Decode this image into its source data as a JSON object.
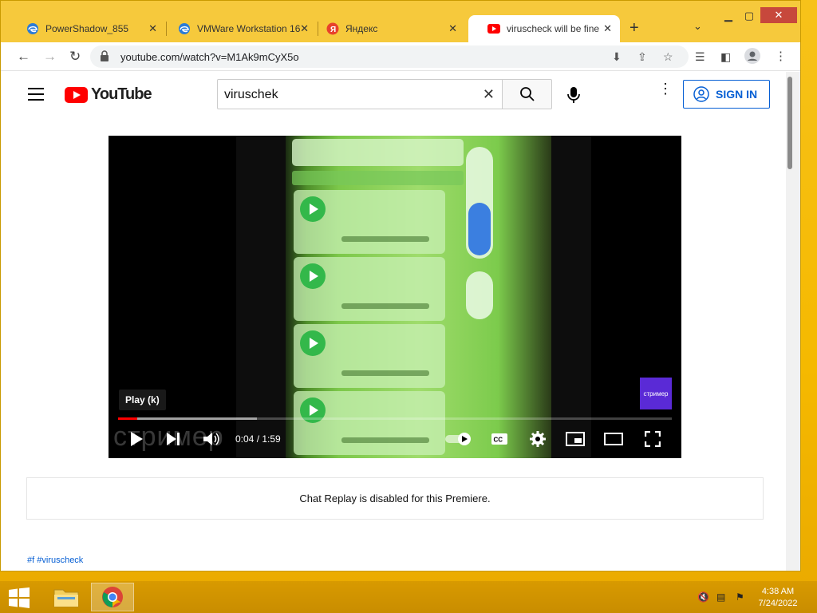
{
  "browser": {
    "tabs": [
      {
        "title": "PowerShadow_855",
        "icon": "edge-icon",
        "active": false
      },
      {
        "title": "VMWare Workstation 16",
        "icon": "edge-icon",
        "active": false
      },
      {
        "title": "Яндекс",
        "icon": "yandex-icon",
        "active": false
      },
      {
        "title": "viruscheck will be fine",
        "icon": "youtube-icon",
        "active": true
      }
    ],
    "new_tab_label": "+",
    "url": "youtube.com/watch?v=M1Ak9mCyX5o"
  },
  "youtube": {
    "logo_text": "YouTube",
    "search_query": "viruschek",
    "sign_in_label": "SIGN IN"
  },
  "player": {
    "tooltip": "Play (k)",
    "current_time": "0:04",
    "duration": "1:59",
    "time_display": "0:04 / 1:59",
    "played_fraction": 0.034,
    "buffered_fraction": 0.25,
    "watermark": "стример",
    "channel_badge": "стример"
  },
  "chat_replay": {
    "message": "Chat Replay is disabled for this Premiere."
  },
  "hashtags": "#f #viruscheck",
  "taskbar": {
    "time": "4:38 AM",
    "date": "7/24/2022"
  },
  "colors": {
    "accent_red": "#ff0000",
    "link_blue": "#065fd4",
    "desktop_orange": "#f5b900"
  }
}
